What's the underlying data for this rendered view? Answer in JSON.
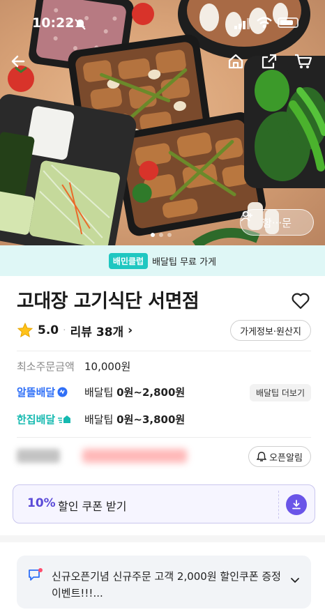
{
  "status_bar": {
    "time": "10:22"
  },
  "hero": {
    "share_label": "함···문",
    "carousel_count": 3,
    "carousel_active": 1
  },
  "club_banner": {
    "badge": "배민클럽",
    "text": "배달팁 무료 가게"
  },
  "store": {
    "name": "고대장 고기식단 서면점",
    "rating": "5.0",
    "review_label": "리뷰",
    "review_count": "38개",
    "info_button": "가게정보·원산지"
  },
  "min_order": {
    "label": "최소주문금액",
    "value": "10,000원"
  },
  "delivery_options": [
    {
      "brand": "알뜰배달",
      "tip_label": "배달팁",
      "tip_value": "0원~2,800원",
      "more": "배달팁 더보기"
    },
    {
      "brand": "한집배달",
      "tip_label": "배달팁",
      "tip_value": "0원~3,800원"
    }
  ],
  "open_alert": {
    "label": "오픈알림"
  },
  "coupon": {
    "percent": "10%",
    "label": "할인 쿠폰 받기"
  },
  "notice": {
    "text": "신규오픈기념 신규주문 고객 2,000원 할인쿠폰 증정 이벤트!!!..."
  },
  "colors": {
    "club": "#1fc7c1",
    "coupon": "#6a55e8",
    "alddeul": "#2f6ff7",
    "hanjip": "#15b9b0"
  }
}
